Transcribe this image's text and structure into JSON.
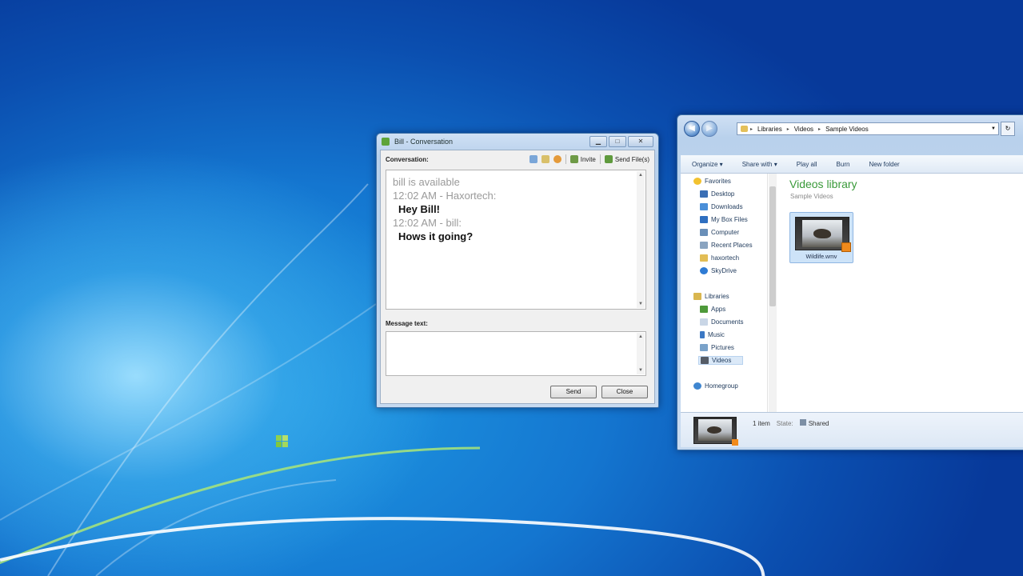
{
  "chat": {
    "title": "Bill - Conversation",
    "toolbar_label": "Conversation:",
    "invite_label": "Invite",
    "send_files_label": "Send File(s)",
    "lines": [
      {
        "kind": "sys",
        "text": "bill is available"
      },
      {
        "kind": "sys",
        "text": "12:02 AM - Haxortech:"
      },
      {
        "kind": "msg",
        "text": "Hey Bill!"
      },
      {
        "kind": "sys",
        "text": "12:02 AM - bill:"
      },
      {
        "kind": "msg",
        "text": "Hows it going?"
      }
    ],
    "message_label": "Message text:",
    "message_value": "",
    "send_label": "Send",
    "close_label": "Close"
  },
  "explorer": {
    "address": {
      "segments": [
        "Libraries",
        "Videos",
        "Sample Videos"
      ]
    },
    "commands": [
      "Organize ▾",
      "Share with ▾",
      "Play all",
      "Burn",
      "New folder"
    ],
    "nav": {
      "favorites_header": "Favorites",
      "favorites": [
        "Desktop",
        "Downloads",
        "My Box Files",
        "Computer",
        "Recent Places",
        "haxortech",
        "SkyDrive"
      ],
      "libraries_header": "Libraries",
      "libraries": [
        "Apps",
        "Documents",
        "Music",
        "Pictures",
        "Videos"
      ],
      "homegroup": "Homegroup"
    },
    "library_title": "Videos library",
    "library_subtitle": "Sample Videos",
    "file_name": "Wildlife.wmv",
    "details": {
      "count": "1 item",
      "state_label": "State:",
      "state_value": "Shared"
    }
  }
}
